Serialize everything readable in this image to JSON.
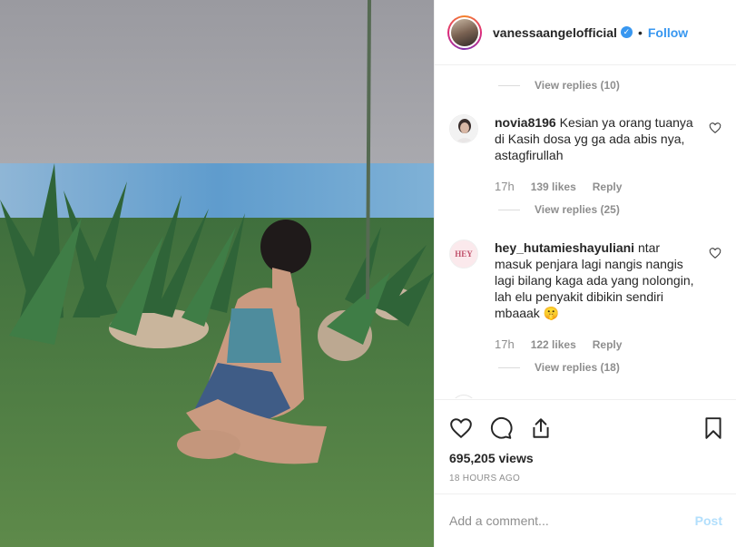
{
  "post": {
    "username": "vanessaangelofficial",
    "verified_icon": "verified-badge-icon",
    "separator": "•",
    "follow_label": "Follow",
    "views": "695,205 views",
    "time_ago": "18 HOURS AGO"
  },
  "comments": {
    "top_view_replies": "View replies (10)",
    "items": [
      {
        "username": "novia8196",
        "text": "Kesian ya orang tuanya di Kasih dosa yg ga ada abis nya, astagfirullah",
        "time": "17h",
        "likes": "139 likes",
        "reply_label": "Reply",
        "view_replies": "View replies (25)"
      },
      {
        "username": "hey_hutamieshayuliani",
        "text": "ntar masuk penjara lagi nangis nangis lagi bilang kaga ada yang nolongin, lah elu penyakit dibikin sendiri mbaaak 🤫",
        "time": "17h",
        "likes": "122 likes",
        "reply_label": "Reply",
        "view_replies": "View replies (18)",
        "avatar_text": "HEY"
      }
    ]
  },
  "add_comment": {
    "placeholder": "Add a comment...",
    "post_label": "Post"
  },
  "colors": {
    "accent": "#3897f0",
    "post_disabled": "#b2dffc",
    "meta": "#8e8e8e"
  }
}
